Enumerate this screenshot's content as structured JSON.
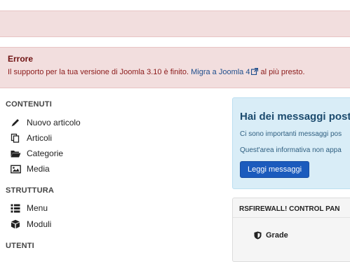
{
  "error_alert": {
    "title": "Errore",
    "message_before": "Il supporto per la tua versione di Joomla 3.10 è finito. ",
    "link_text": "Migra a Joomla 4",
    "message_after": " al più presto."
  },
  "sidebar": {
    "sections": [
      {
        "title": "CONTENUTI",
        "items": [
          {
            "label": "Nuovo articolo",
            "icon": "pencil-icon"
          },
          {
            "label": "Articoli",
            "icon": "copy-icon"
          },
          {
            "label": "Categorie",
            "icon": "folder-icon"
          },
          {
            "label": "Media",
            "icon": "image-icon"
          }
        ]
      },
      {
        "title": "STRUTTURA",
        "items": [
          {
            "label": "Menu",
            "icon": "list-icon"
          },
          {
            "label": "Moduli",
            "icon": "cube-icon"
          }
        ]
      },
      {
        "title": "UTENTI",
        "items": []
      }
    ]
  },
  "messages_panel": {
    "heading": "Hai dei messaggi post",
    "line1": "Ci sono importanti messaggi pos",
    "line2": "Quest'area informativa non appa",
    "button_label": "Leggi messaggi"
  },
  "rsfirewall_panel": {
    "heading": "RSFIREWALL! CONTROL PAN",
    "grade_label": "Grade"
  },
  "colors": {
    "alert_bg": "#f2dede",
    "alert_text": "#8b1a1a",
    "info_bg": "#d9edf7",
    "primary_button": "#1b5bbd"
  }
}
